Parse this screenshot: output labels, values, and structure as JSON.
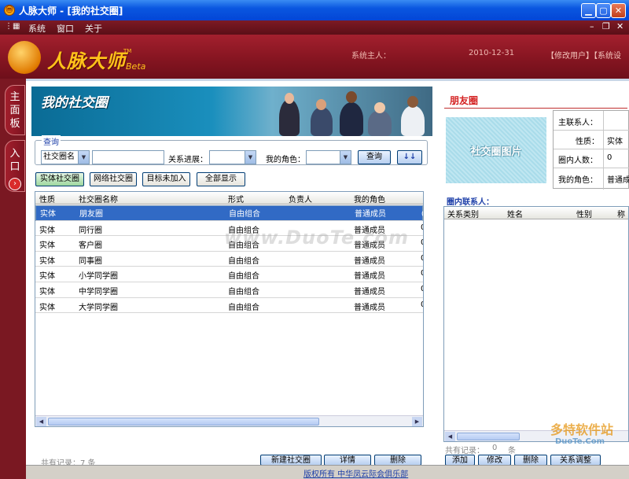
{
  "window": {
    "title": "人脉大师 - [我的社交圈]",
    "app_icon": "app-logo-icon"
  },
  "menu": {
    "items": [
      "系统",
      "窗口",
      "关于"
    ]
  },
  "header": {
    "logo": "人脉大师",
    "tm": "TM",
    "beta": "Beta",
    "owner_label": "系统主人：",
    "date": "2010-12-31",
    "links": "【修改用户】【系统设"
  },
  "side_tabs": {
    "main": "主面板",
    "entry": "入口"
  },
  "banner": {
    "title": "我的社交圈"
  },
  "query": {
    "legend": "查询",
    "field_select": "社交圈名",
    "relation_label": "关系进展：",
    "role_label": "我的角色：",
    "search_button": "查询",
    "sort_button": "↓↓"
  },
  "tabs": [
    "实体社交圈",
    "网络社交圈",
    "目标未加入",
    "全部显示"
  ],
  "table": {
    "columns": [
      "性质",
      "社交圈名称",
      "形式",
      "负责人",
      "我的角色"
    ],
    "rows": [
      [
        "实体",
        "朋友圈",
        "自由组合",
        "",
        "普通成员",
        "0"
      ],
      [
        "实体",
        "同行圈",
        "自由组合",
        "",
        "普通成员",
        "0"
      ],
      [
        "实体",
        "客户圈",
        "自由组合",
        "",
        "普通成员",
        "0"
      ],
      [
        "实体",
        "同事圈",
        "自由组合",
        "",
        "普通成员",
        "0"
      ],
      [
        "实体",
        "小学同学圈",
        "自由组合",
        "",
        "普通成员",
        "0"
      ],
      [
        "实体",
        "中学同学圈",
        "自由组合",
        "",
        "普通成员",
        "0"
      ],
      [
        "实体",
        "大学同学圈",
        "自由组合",
        "",
        "普通成员",
        "0"
      ]
    ],
    "selected_row": 0
  },
  "left_bottom": {
    "count_text": "共有记录：7 条",
    "buttons": [
      "新建社交圈",
      "详情",
      "删除"
    ]
  },
  "right_panel": {
    "title": "朋友圈",
    "photo_text": "社交圈图片",
    "info": [
      {
        "label": "主联系人：",
        "value": ""
      },
      {
        "label": "性质：",
        "value": "实体"
      },
      {
        "label": "圈内人数：",
        "value": "0"
      },
      {
        "label": "我的角色：",
        "value": "普通成"
      }
    ],
    "members_label": "圈内联系人：",
    "member_columns": [
      "关系类别",
      "姓名",
      "性别",
      "称"
    ],
    "count_label": "共有记录：",
    "count_value": "0",
    "count_unit": "条",
    "buttons": [
      "添加",
      "修改",
      "删除",
      "关系调整"
    ]
  },
  "footer": {
    "text": "版权所有 中华凤云际会俱乐部"
  },
  "watermark": {
    "center": "www.DuoTe.com",
    "corner": "多特软件站",
    "corner_url": "DuoTe.Com"
  }
}
